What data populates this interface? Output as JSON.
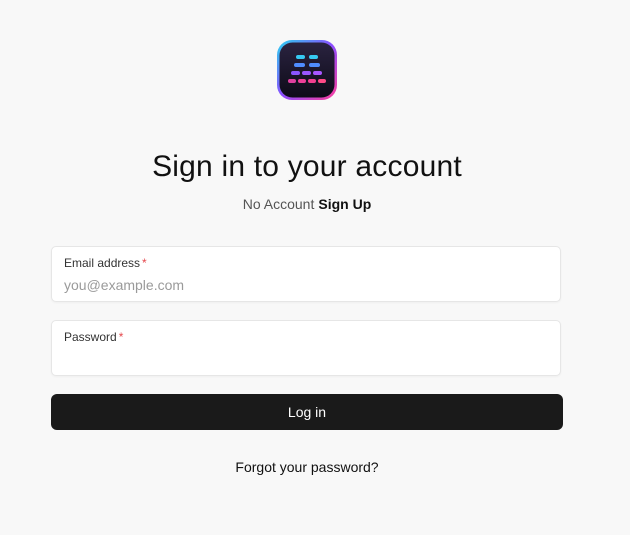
{
  "app": {
    "logo_icon": "equalizer-bars-app-icon",
    "accent_colors": [
      "#29d3f0",
      "#8b4dff",
      "#ff3d9a"
    ]
  },
  "header": {
    "title": "Sign in to your account",
    "no_account_text": "No Account",
    "sign_up_label": "Sign Up"
  },
  "form": {
    "email": {
      "label": "Email address",
      "required_marker": "*",
      "value": "",
      "placeholder": "you@example.com"
    },
    "password": {
      "label": "Password",
      "required_marker": "*",
      "value": "",
      "placeholder": ""
    },
    "submit_label": "Log in",
    "forgot_label": "Forgot your password?"
  },
  "colors": {
    "background": "#f8f8f8",
    "button": "#1a1a1a",
    "required": "#e5484d"
  }
}
